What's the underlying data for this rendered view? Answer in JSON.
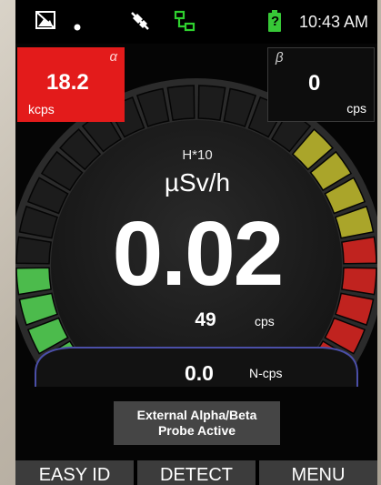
{
  "status_bar": {
    "time": "10:43 AM",
    "battery_label": "?",
    "icons": [
      "image-icon",
      "dot-icon",
      "satellite-off-icon",
      "network-icon",
      "battery-icon"
    ]
  },
  "alpha_panel": {
    "symbol": "α",
    "value": "18.2",
    "unit": "kcps",
    "color": "#e31b1b"
  },
  "beta_panel": {
    "symbol": "β",
    "value": "0",
    "unit": "cps"
  },
  "gauge": {
    "label": "H*10",
    "unit": "µSv/h",
    "reading": "0.02",
    "cps_value": "49",
    "cps_unit": "cps",
    "ncps_value": "0.0",
    "ncps_unit": "N-cps",
    "colors": {
      "green": "#4cbb4c",
      "yellow": "#aaa52a",
      "red": "#c0231f",
      "idle": "#1c1c1c"
    }
  },
  "probe_notice": {
    "line1": "External Alpha/Beta",
    "line2": "Probe Active"
  },
  "buttons": {
    "easy_id": "EASY ID",
    "detect": "DETECT",
    "menu": "MENU"
  }
}
